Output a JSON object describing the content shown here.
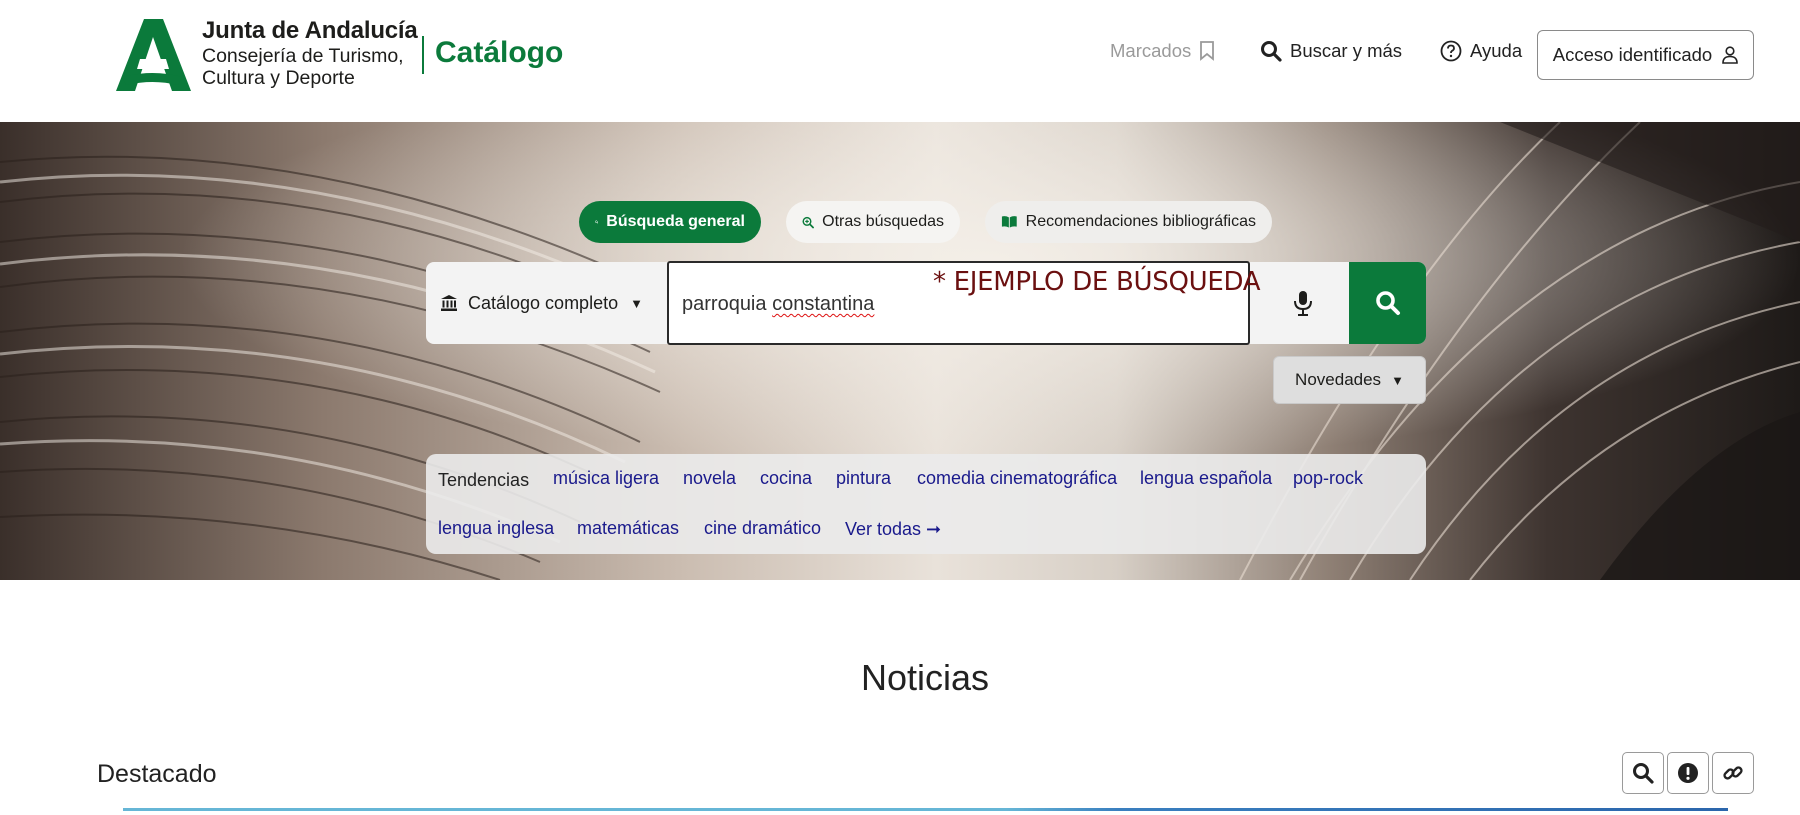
{
  "header": {
    "org_line1": "Junta de Andalucía",
    "org_line2": "Consejería de Turismo,",
    "org_line3": "Cultura y Deporte",
    "app_title": "Catálogo",
    "nav": {
      "marcados": "Marcados",
      "buscar": "Buscar y más",
      "ayuda": "Ayuda",
      "acceso": "Acceso identificado"
    }
  },
  "search": {
    "tabs": [
      {
        "label": "Búsqueda general",
        "active": true,
        "icon": "search-icon"
      },
      {
        "label": "Otras búsquedas",
        "active": false,
        "icon": "zoom-in-icon"
      },
      {
        "label": "Recomendaciones bibliográficas",
        "active": false,
        "icon": "book-open-icon"
      }
    ],
    "scope": "Catálogo completo",
    "query_word1": "parroquia",
    "query_word2": "constantina",
    "annotation": "* EJEMPLO DE BÚSQUEDA",
    "novedades": "Novedades"
  },
  "tendencias": {
    "label": "Tendencias",
    "items": [
      "música ligera",
      "novela",
      "cocina",
      "pintura",
      "comedia cinematográfica",
      "lengua española",
      "pop-rock",
      "lengua inglesa",
      "matemáticas",
      "cine dramático"
    ],
    "ver_todas": "Ver todas ➞"
  },
  "content": {
    "noticias": "Noticias",
    "destacado": "Destacado"
  },
  "colors": {
    "brand_green": "#0b7a3b",
    "link_blue": "#1a1a8c",
    "annotation_red": "#6b1010"
  }
}
